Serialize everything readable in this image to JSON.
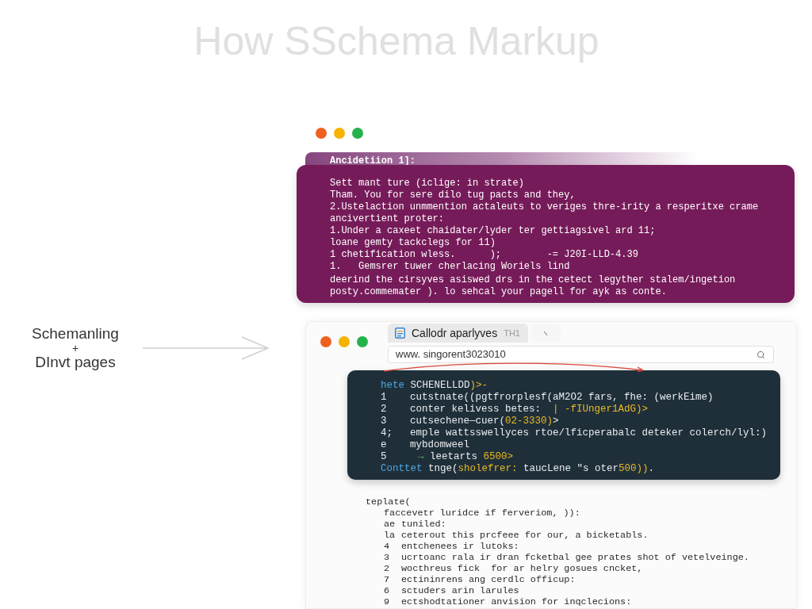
{
  "title": "How SSchema Markup",
  "flow_label": [
    "Schemanling",
    "+",
    "DInvt pages"
  ],
  "top_window": {
    "header": "Ancidetiion 1]:",
    "paragraphs": [
      [
        "Sett mant ture (iclige: in strate)",
        "Tham. You for sere dilo tug pacts and they,",
        "2.Ustelaction unmmention actaleuts to veriges thre-irity a resperitxe crame",
        "ancivertient proter:",
        "1.Under a caxeet chaidater/lyder ter gettiagsivel ard 11;",
        "loane gemty tackclegs for 11)",
        "1 chetification wless.      );        -= J20I-LLD-4.39",
        "1.   Gemsrer tuwer cherlacing Woriels lind"
      ],
      [
        "deerind the cirsyves asiswed drs in the cetect legyther stalem/ingetion",
        "posty.commemater ). lo sehcal your pagell for ayk as conte."
      ]
    ]
  },
  "browser": {
    "tabs": [
      {
        "kind": "labeled",
        "label": "Callodr aparlyves",
        "hint": "TH1",
        "selected": true
      },
      {
        "kind": "icon",
        "selected": false
      }
    ],
    "address_bar": {
      "value": "www. singorent3023010"
    },
    "code": {
      "lines": [
        {
          "segments": [
            {
              "kind": "keyword",
              "text": "hete"
            },
            {
              "kind": "plain",
              "text": " SCHENELLDD"
            },
            {
              "kind": "value",
              "text": ")>-"
            }
          ]
        },
        {
          "number": "1",
          "segments": [
            {
              "kind": "plain",
              "text": "cutstnate((pgtfrorplesf(aM2O2 fars, fhe: (werkEime)"
            }
          ]
        },
        {
          "number": "2",
          "segments": [
            {
              "kind": "plain",
              "text": "conter kelivess betes:  "
            },
            {
              "kind": "value",
              "text": "| -fIUnger1AdG)>"
            }
          ]
        },
        {
          "number": "3",
          "segments": [
            {
              "kind": "plain",
              "text": "cutsechene—cuer("
            },
            {
              "kind": "value",
              "text": "02-3330)"
            },
            {
              "kind": "plain",
              "text": ">"
            }
          ]
        },
        {
          "number": "4;",
          "segments": [
            {
              "kind": "plain",
              "text": "emple wattsswellyces rtoe/lficperabalc deteker colerch/lyl:)"
            }
          ]
        },
        {
          "number": "e",
          "segments": [
            {
              "kind": "plain",
              "text": "mybdomweel"
            }
          ]
        },
        {
          "number": "5",
          "segments": [
            {
              "kind": "arrow",
              "text": "→"
            },
            {
              "kind": "plain",
              "text": " leetarts "
            },
            {
              "kind": "value",
              "text": "6500>"
            }
          ]
        },
        {
          "segments": [
            {
              "kind": "keyword",
              "text": "Conttet"
            },
            {
              "kind": "plain",
              "text": " tnge("
            },
            {
              "kind": "value",
              "text": "sholefrer:"
            },
            {
              "kind": "plain",
              "text": " taucLene \"s oter"
            },
            {
              "kind": "value",
              "text": "500))"
            },
            {
              "kind": "plain",
              "text": "."
            }
          ]
        }
      ]
    },
    "listing": {
      "opening": "teplate(",
      "lines": [
        {
          "text": "faccevetr luridce if ferveriom, )):"
        },
        {
          "number": "ae",
          "text": "tuniled:"
        },
        {
          "number": "la",
          "text": "ceterout this prcfeee for our, a bicketabls."
        },
        {
          "number": "4",
          "text": "entchenees ir lutoks:"
        },
        {
          "number": "3",
          "text": "ucrtoanc rala ir dran fcketbal gee prates shot of vetelveinge."
        },
        {
          "number": "2",
          "text": "wocthreus fick  for ar helry gosues cncket,"
        },
        {
          "number": "7",
          "text": "ectininrens ang cerdlc officup:"
        },
        {
          "number": "6",
          "text": "sctuders arin larules"
        },
        {
          "number": "9",
          "text": "ectshodtationer anvision for inqclecions:"
        }
      ]
    }
  }
}
